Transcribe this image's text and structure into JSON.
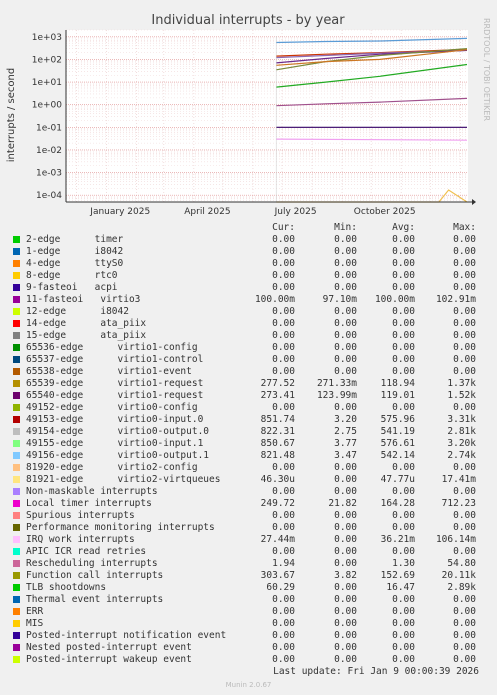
{
  "chart_data": {
    "type": "line",
    "title": "Individual interrupts - by year",
    "ylabel": "interrupts / second",
    "yscale": "log",
    "ylim": [
      5e-05,
      2000
    ],
    "y_ticks": [
      "1e+03",
      "1e+02",
      "1e+01",
      "1e+00",
      "1e-01",
      "1e-02",
      "1e-03",
      "1e-04"
    ],
    "x_ticks": [
      "January 2025",
      "April 2025",
      "July 2025",
      "October 2025"
    ],
    "x_range": [
      "2024-11-20",
      "2026-01-09"
    ],
    "data_start": "2025-06-25",
    "grid": true,
    "side_label": "RRDTOOL / TOBI OETIKER",
    "series": [
      {
        "name": "virtio0-input.1",
        "color": "#5b9bd5",
        "x": [
          "2025-06-25",
          "2025-08-15",
          "2025-10-10",
          "2026-01-08"
        ],
        "values": [
          560,
          620,
          650,
          850
        ]
      },
      {
        "name": "virtio0-input.0",
        "color": "#cc3300",
        "x": [
          "2025-06-25",
          "2025-08-15",
          "2025-10-10",
          "2026-01-08"
        ],
        "values": [
          140,
          170,
          200,
          280
        ]
      },
      {
        "name": "virtio0-output.0",
        "color": "#8e6ab3",
        "x": [
          "2025-06-25",
          "2025-08-15",
          "2025-10-10",
          "2026-01-08"
        ],
        "values": [
          120,
          150,
          190,
          250
        ]
      },
      {
        "name": "Local timer interrupts",
        "color": "#6b2a8a",
        "x": [
          "2025-06-25",
          "2025-08-15",
          "2025-10-10",
          "2026-01-08"
        ],
        "values": [
          70,
          110,
          170,
          250
        ]
      },
      {
        "name": "Function call interrupts",
        "color": "#7a8a3a",
        "x": [
          "2025-06-25",
          "2025-08-15",
          "2025-10-10",
          "2026-01-08"
        ],
        "values": [
          35,
          80,
          150,
          300
        ]
      },
      {
        "name": "virtio1-request",
        "color": "#cc7722",
        "x": [
          "2025-06-25",
          "2025-08-15",
          "2025-10-10",
          "2026-01-08"
        ],
        "values": [
          55,
          80,
          100,
          270
        ]
      },
      {
        "name": "TLB shootdowns",
        "color": "#22aa22",
        "x": [
          "2025-06-25",
          "2025-08-15",
          "2025-10-10",
          "2026-01-08"
        ],
        "values": [
          6,
          10,
          18,
          60
        ]
      },
      {
        "name": "Rescheduling interrupts",
        "color": "#a0508c",
        "x": [
          "2025-06-25",
          "2025-08-15",
          "2025-10-10",
          "2026-01-08"
        ],
        "values": [
          0.9,
          1.1,
          1.3,
          1.9
        ]
      },
      {
        "name": "11-fasteoi virtio3",
        "color": "#330066",
        "x": [
          "2025-06-25",
          "2026-01-08"
        ],
        "values": [
          0.1,
          0.1
        ]
      },
      {
        "name": "IRQ work interrupts",
        "color": "#f0a0f0",
        "x": [
          "2025-06-25",
          "2026-01-08"
        ],
        "values": [
          0.03,
          0.027
        ]
      },
      {
        "name": "virtio2-virtqueues",
        "color": "#f0c050",
        "x": [
          "2025-06-25",
          "2025-12-10",
          "2025-12-20",
          "2026-01-08"
        ],
        "values": [
          5e-05,
          5e-05,
          0.00017,
          5e-05
        ]
      }
    ]
  },
  "legend": {
    "headers": {
      "cur": "Cur:",
      "min": "Min:",
      "avg": "Avg:",
      "max": "Max:"
    },
    "rows": [
      {
        "name": "2-edge      timer",
        "color": "#00cc00",
        "cur": "0.00",
        "min": "0.00",
        "avg": "0.00",
        "max": "0.00"
      },
      {
        "name": "1-edge      i8042",
        "color": "#0066b3",
        "cur": "0.00",
        "min": "0.00",
        "avg": "0.00",
        "max": "0.00"
      },
      {
        "name": "4-edge      ttyS0",
        "color": "#ff8000",
        "cur": "0.00",
        "min": "0.00",
        "avg": "0.00",
        "max": "0.00"
      },
      {
        "name": "8-edge      rtc0",
        "color": "#ffcc00",
        "cur": "0.00",
        "min": "0.00",
        "avg": "0.00",
        "max": "0.00"
      },
      {
        "name": "9-fasteoi   acpi",
        "color": "#330099",
        "cur": "0.00",
        "min": "0.00",
        "avg": "0.00",
        "max": "0.00"
      },
      {
        "name": "11-fasteoi   virtio3",
        "color": "#990099",
        "cur": "100.00m",
        "min": "97.10m",
        "avg": "100.00m",
        "max": "102.91m"
      },
      {
        "name": "12-edge      i8042",
        "color": "#ccff00",
        "cur": "0.00",
        "min": "0.00",
        "avg": "0.00",
        "max": "0.00"
      },
      {
        "name": "14-edge      ata_piix",
        "color": "#ff0000",
        "cur": "0.00",
        "min": "0.00",
        "avg": "0.00",
        "max": "0.00"
      },
      {
        "name": "15-edge      ata_piix",
        "color": "#808080",
        "cur": "0.00",
        "min": "0.00",
        "avg": "0.00",
        "max": "0.00"
      },
      {
        "name": "65536-edge      virtio1-config",
        "color": "#008f00",
        "cur": "0.00",
        "min": "0.00",
        "avg": "0.00",
        "max": "0.00"
      },
      {
        "name": "65537-edge      virtio1-control",
        "color": "#00487d",
        "cur": "0.00",
        "min": "0.00",
        "avg": "0.00",
        "max": "0.00"
      },
      {
        "name": "65538-edge      virtio1-event",
        "color": "#b35a00",
        "cur": "0.00",
        "min": "0.00",
        "avg": "0.00",
        "max": "0.00"
      },
      {
        "name": "65539-edge      virtio1-request",
        "color": "#b38f00",
        "cur": "277.52",
        "min": "271.33m",
        "avg": "118.94",
        "max": "1.37k"
      },
      {
        "name": "65540-edge      virtio1-request",
        "color": "#6b006b",
        "cur": "273.41",
        "min": "123.99m",
        "avg": "119.01",
        "max": "1.52k"
      },
      {
        "name": "49152-edge      virtio0-config",
        "color": "#8fb300",
        "cur": "0.00",
        "min": "0.00",
        "avg": "0.00",
        "max": "0.00"
      },
      {
        "name": "49153-edge      virtio0-input.0",
        "color": "#b30000",
        "cur": "851.74",
        "min": "3.20",
        "avg": "575.96",
        "max": "3.31k"
      },
      {
        "name": "49154-edge      virtio0-output.0",
        "color": "#bebebe",
        "cur": "822.31",
        "min": "2.75",
        "avg": "541.19",
        "max": "2.81k"
      },
      {
        "name": "49155-edge      virtio0-input.1",
        "color": "#80ff80",
        "cur": "850.67",
        "min": "3.77",
        "avg": "576.61",
        "max": "3.20k"
      },
      {
        "name": "49156-edge      virtio0-output.1",
        "color": "#80c9ff",
        "cur": "821.48",
        "min": "3.47",
        "avg": "542.14",
        "max": "2.74k"
      },
      {
        "name": "81920-edge      virtio2-config",
        "color": "#ffc080",
        "cur": "0.00",
        "min": "0.00",
        "avg": "0.00",
        "max": "0.00"
      },
      {
        "name": "81921-edge      virtio2-virtqueues",
        "color": "#ffe680",
        "cur": "46.30u",
        "min": "0.00",
        "avg": "47.77u",
        "max": "17.41m"
      },
      {
        "name": "Non-maskable interrupts",
        "color": "#aa80ff",
        "cur": "0.00",
        "min": "0.00",
        "avg": "0.00",
        "max": "0.00"
      },
      {
        "name": "Local timer interrupts",
        "color": "#ee00cc",
        "cur": "249.72",
        "min": "21.82",
        "avg": "164.28",
        "max": "712.23"
      },
      {
        "name": "Spurious interrupts",
        "color": "#ff8080",
        "cur": "0.00",
        "min": "0.00",
        "avg": "0.00",
        "max": "0.00"
      },
      {
        "name": "Performance monitoring interrupts",
        "color": "#666600",
        "cur": "0.00",
        "min": "0.00",
        "avg": "0.00",
        "max": "0.00"
      },
      {
        "name": "IRQ work interrupts",
        "color": "#ffbfff",
        "cur": "27.44m",
        "min": "0.00",
        "avg": "36.21m",
        "max": "106.14m"
      },
      {
        "name": "APIC ICR read retries",
        "color": "#00ffcc",
        "cur": "0.00",
        "min": "0.00",
        "avg": "0.00",
        "max": "0.00"
      },
      {
        "name": "Rescheduling interrupts",
        "color": "#cc6699",
        "cur": "1.94",
        "min": "0.00",
        "avg": "1.30",
        "max": "54.80"
      },
      {
        "name": "Function call interrupts",
        "color": "#999900",
        "cur": "303.67",
        "min": "3.82",
        "avg": "152.69",
        "max": "20.11k"
      },
      {
        "name": "TLB shootdowns",
        "color": "#00cc00",
        "cur": "60.29",
        "min": "0.00",
        "avg": "16.47",
        "max": "2.89k"
      },
      {
        "name": "Thermal event interrupts",
        "color": "#0066b3",
        "cur": "0.00",
        "min": "0.00",
        "avg": "0.00",
        "max": "0.00"
      },
      {
        "name": "ERR",
        "color": "#ff8000",
        "cur": "0.00",
        "min": "0.00",
        "avg": "0.00",
        "max": "0.00"
      },
      {
        "name": "MIS",
        "color": "#ffcc00",
        "cur": "0.00",
        "min": "0.00",
        "avg": "0.00",
        "max": "0.00"
      },
      {
        "name": "Posted-interrupt notification event",
        "color": "#330099",
        "cur": "0.00",
        "min": "0.00",
        "avg": "0.00",
        "max": "0.00"
      },
      {
        "name": "Nested posted-interrupt event",
        "color": "#990099",
        "cur": "0.00",
        "min": "0.00",
        "avg": "0.00",
        "max": "0.00"
      },
      {
        "name": "Posted-interrupt wakeup event",
        "color": "#ccff00",
        "cur": "0.00",
        "min": "0.00",
        "avg": "0.00",
        "max": "0.00"
      }
    ]
  },
  "footer": {
    "last_update": "Last update: Fri Jan  9 00:00:39 2026",
    "version": "Munin 2.0.67"
  }
}
